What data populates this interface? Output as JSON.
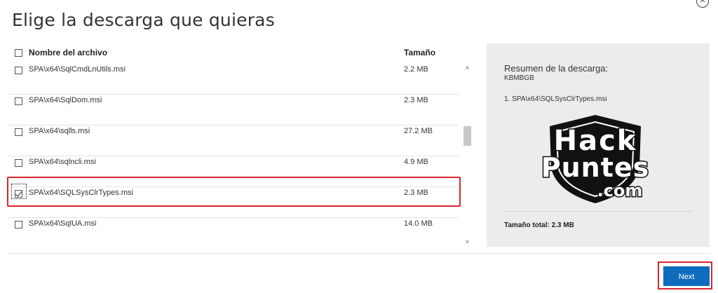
{
  "dialog": {
    "title": "Elige la descarga que quieras",
    "close_glyph": "✕"
  },
  "table": {
    "header_name": "Nombre del archivo",
    "header_size": "Tamaño",
    "rows": [
      {
        "name": "SPA\\x64\\SqlCmdLnUtils.msi",
        "size": "2.2 MB",
        "checked": false
      },
      {
        "name": "SPA\\x64\\SqlDom.msi",
        "size": "2.3 MB",
        "checked": false
      },
      {
        "name": "SPA\\x64\\sqlls.msi",
        "size": "27.2 MB",
        "checked": false
      },
      {
        "name": "SPA\\x64\\sqlncli.msi",
        "size": "4.9 MB",
        "checked": false
      },
      {
        "name": "SPA\\x64\\SQLSysClrTypes.msi",
        "size": "2.3 MB",
        "checked": true
      },
      {
        "name": "SPA\\x64\\SqlUA.msi",
        "size": "14.0 MB",
        "checked": false
      }
    ]
  },
  "scrollbar": {
    "up_glyph": "˄",
    "down_glyph": "˅"
  },
  "summary": {
    "title": "Resumen de la descarga:",
    "code": "KBMBGB",
    "items": [
      "1. SPA\\x64\\SQLSysClrTypes.msi"
    ],
    "total": "Tamaño total: 2.3 MB",
    "watermark_line1": "Hack",
    "watermark_line2": "Puntes",
    "watermark_line3": ".com"
  },
  "footer": {
    "next_label": "Next"
  },
  "colors": {
    "accent": "#0f6cbd",
    "highlight": "#d9262e",
    "panel": "#ececec"
  },
  "icons": {
    "close": "close-icon",
    "watermark": "shield-logo-icon"
  }
}
